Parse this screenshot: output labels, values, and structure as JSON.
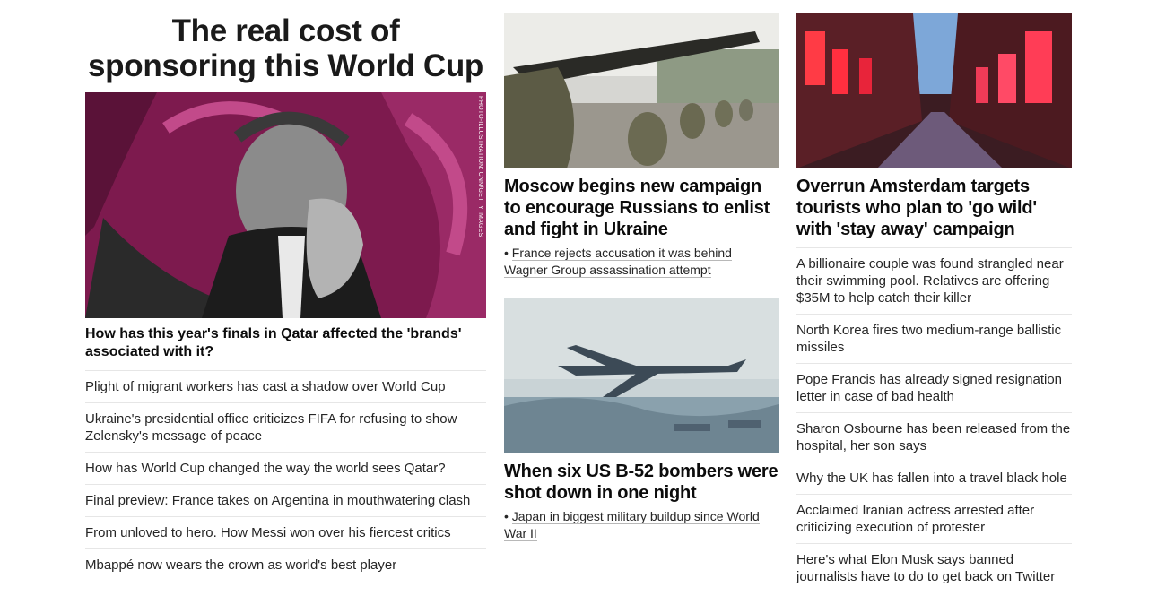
{
  "feature": {
    "title": "The real cost of sponsoring this World Cup",
    "image_credit": "PHOTO-ILLUSTRATION: CNN/GETTY IMAGES",
    "lead_headline": "How has this year's finals in Qatar affected the 'brands' associated with it?",
    "links": [
      "Plight of migrant workers has cast a shadow over World Cup",
      "Ukraine's presidential office criticizes FIFA for refusing to show Zelensky's message of peace",
      "How has World Cup changed the way the world sees Qatar?",
      "Final preview: France takes on Argentina in mouthwatering clash",
      "From unloved to hero. How Messi won over his fiercest critics",
      "Mbappé now wears the crown as world's best player"
    ]
  },
  "middle": {
    "story1": {
      "headline": "Moscow begins new campaign to encourage Russians to enlist and fight in Ukraine",
      "related": "France rejects accusation it was behind Wagner Group assassination attempt"
    },
    "story2": {
      "headline": "When six US B-52 bombers were shot down in one night",
      "related": "Japan in biggest military buildup since World War II"
    }
  },
  "right": {
    "headline": "Overrun Amsterdam targets tourists who plan to 'go wild' with 'stay away' campaign",
    "links": [
      "A billionaire couple was found strangled near their swimming pool. Relatives are offering $35M to help catch their killer",
      "North Korea fires two medium-range ballistic missiles",
      "Pope Francis has already signed resignation letter in case of bad health",
      "Sharon Osbourne has been released from the hospital, her son says",
      "Why the UK has fallen into a travel black hole",
      "Acclaimed Iranian actress arrested after criticizing execution of protester",
      "Here's what Elon Musk says banned journalists have to do to get back on Twitter"
    ]
  },
  "colors": {
    "text": "#0c0c0c",
    "divider": "#e6e6e6",
    "magenta": "#8a1a55"
  }
}
